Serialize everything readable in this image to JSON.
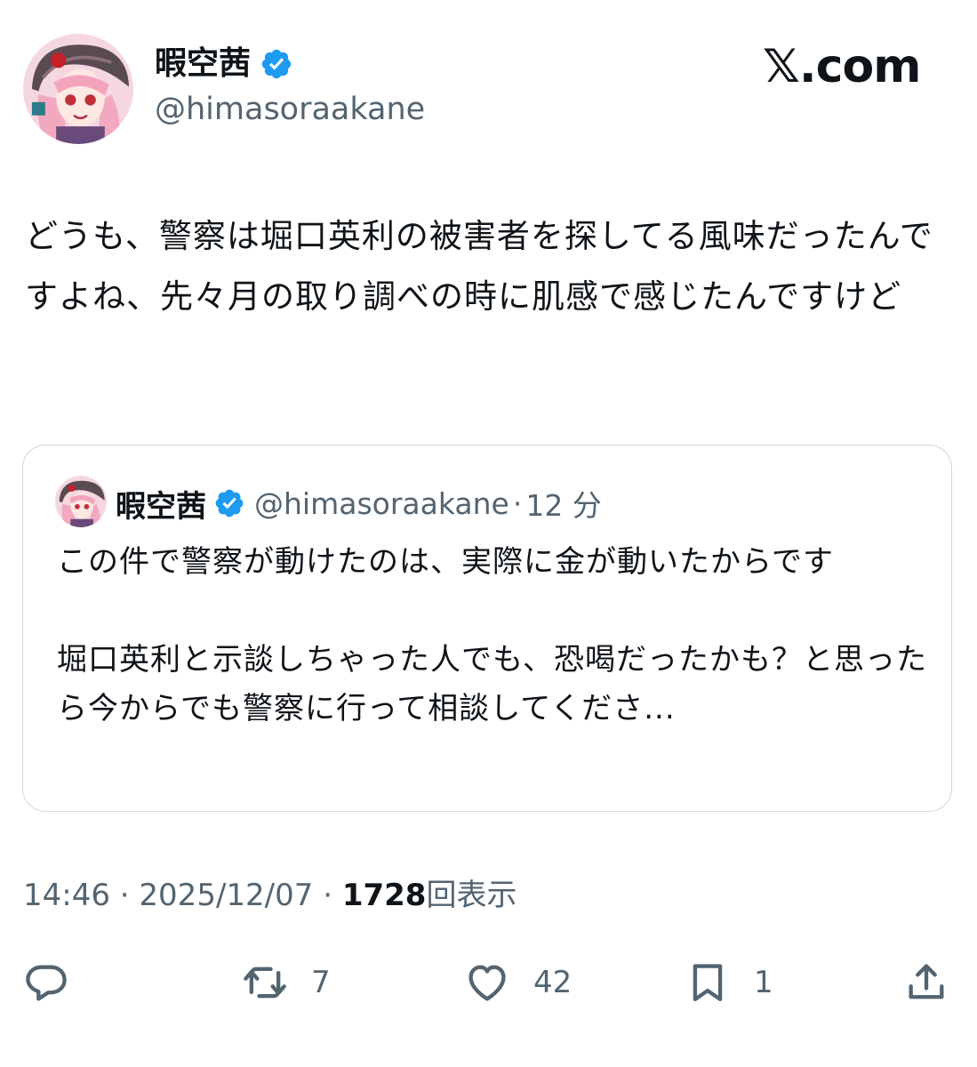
{
  "header": {
    "display_name": "暇空茜",
    "handle": "@himasoraakane",
    "brand": "𝕏.com",
    "verified_icon": "verified-badge-icon",
    "accent_color": "#1d9bf0"
  },
  "tweet": {
    "text": "どうも、警察は堀口英利の被害者を探してる風味だったんですよね、先々月の取り調べの時に肌感で感じたんですけど"
  },
  "quote": {
    "display_name": "暇空茜",
    "handle": "@himasoraakane",
    "separator": "·",
    "time": "12 分",
    "text": "この件で警察が動けたのは、実際に金が動いたからです\n\n堀口英利と示談しちゃった人でも、恐喝だったかも？と思ったら今からでも警察に行って相談してくださ..."
  },
  "meta": {
    "time": "14:46",
    "separator": "·",
    "date": "2025/12/07",
    "views_count": "1728",
    "views_label": "回表示"
  },
  "actions": {
    "reply": {
      "icon": "reply-icon",
      "count": ""
    },
    "repost": {
      "icon": "repost-icon",
      "count": "7"
    },
    "like": {
      "icon": "heart-icon",
      "count": "42"
    },
    "bookmark": {
      "icon": "bookmark-icon",
      "count": "1"
    },
    "share": {
      "icon": "share-icon",
      "count": ""
    }
  }
}
